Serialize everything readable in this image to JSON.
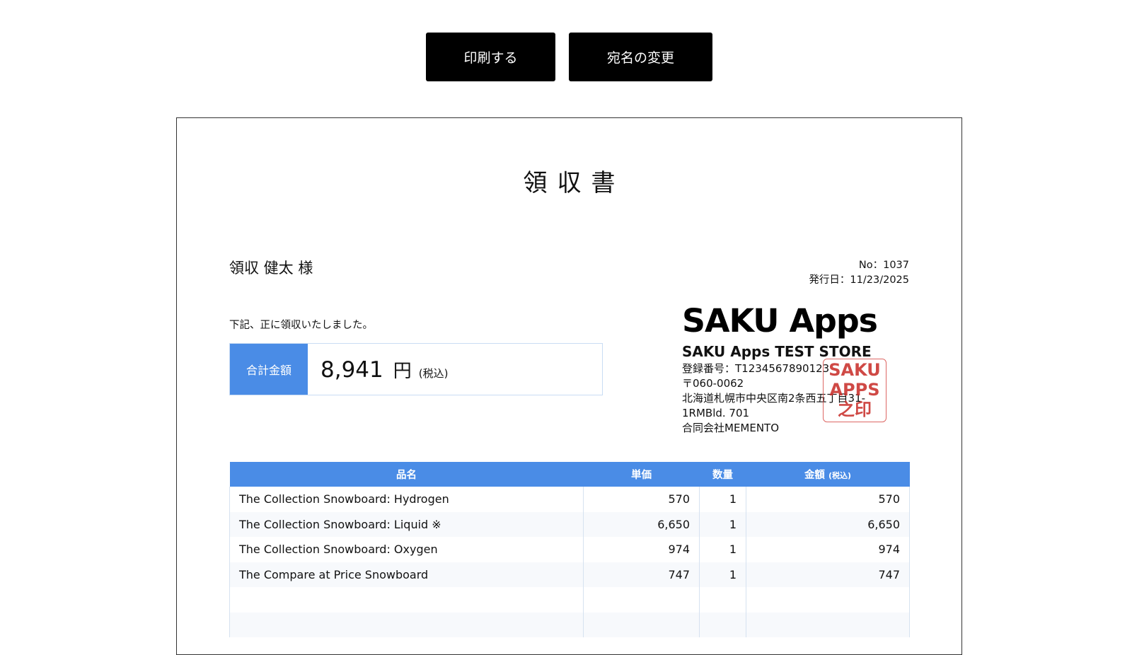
{
  "buttons": {
    "print": "印刷する",
    "rename": "宛名の変更"
  },
  "receipt": {
    "title": "領収書",
    "recipient": "領収 健太 様",
    "number": "No：1037",
    "issue_date": "発行日：11/23/2025",
    "received_text": "下記、正に領収いたしました。",
    "total": {
      "label": "合計金額",
      "amount": "8,941",
      "currency": "円",
      "tax_note": "(税込)"
    },
    "store": {
      "logo": "SAKU Apps",
      "name": "SAKU Apps TEST STORE",
      "registration": "登録番号：T1234567890123",
      "postal": "〒060-0062",
      "address1": "北海道札幌市中央区南2条西五丁目31-",
      "address2": "1RMBld. 701",
      "company": "合同会社MEMENTO",
      "stamp_lines": [
        "SAKU",
        "APPS",
        "之印"
      ]
    },
    "table": {
      "headers": {
        "name": "品名",
        "unit_price": "単価",
        "quantity": "数量",
        "amount": "金額",
        "amount_note": "(税込)"
      },
      "rows": [
        {
          "name": "The Collection Snowboard: Hydrogen",
          "unit_price": "570",
          "quantity": "1",
          "amount": "570"
        },
        {
          "name": "The Collection Snowboard: Liquid ※",
          "unit_price": "6,650",
          "quantity": "1",
          "amount": "6,650"
        },
        {
          "name": "The Collection Snowboard: Oxygen",
          "unit_price": "974",
          "quantity": "1",
          "amount": "974"
        },
        {
          "name": "The Compare at Price Snowboard",
          "unit_price": "747",
          "quantity": "1",
          "amount": "747"
        },
        {
          "name": "",
          "unit_price": "",
          "quantity": "",
          "amount": ""
        },
        {
          "name": "",
          "unit_price": "",
          "quantity": "",
          "amount": ""
        }
      ]
    }
  },
  "colors": {
    "accent": "#4a8ce6",
    "stamp": "#c9302c",
    "button_bg": "#000000"
  }
}
